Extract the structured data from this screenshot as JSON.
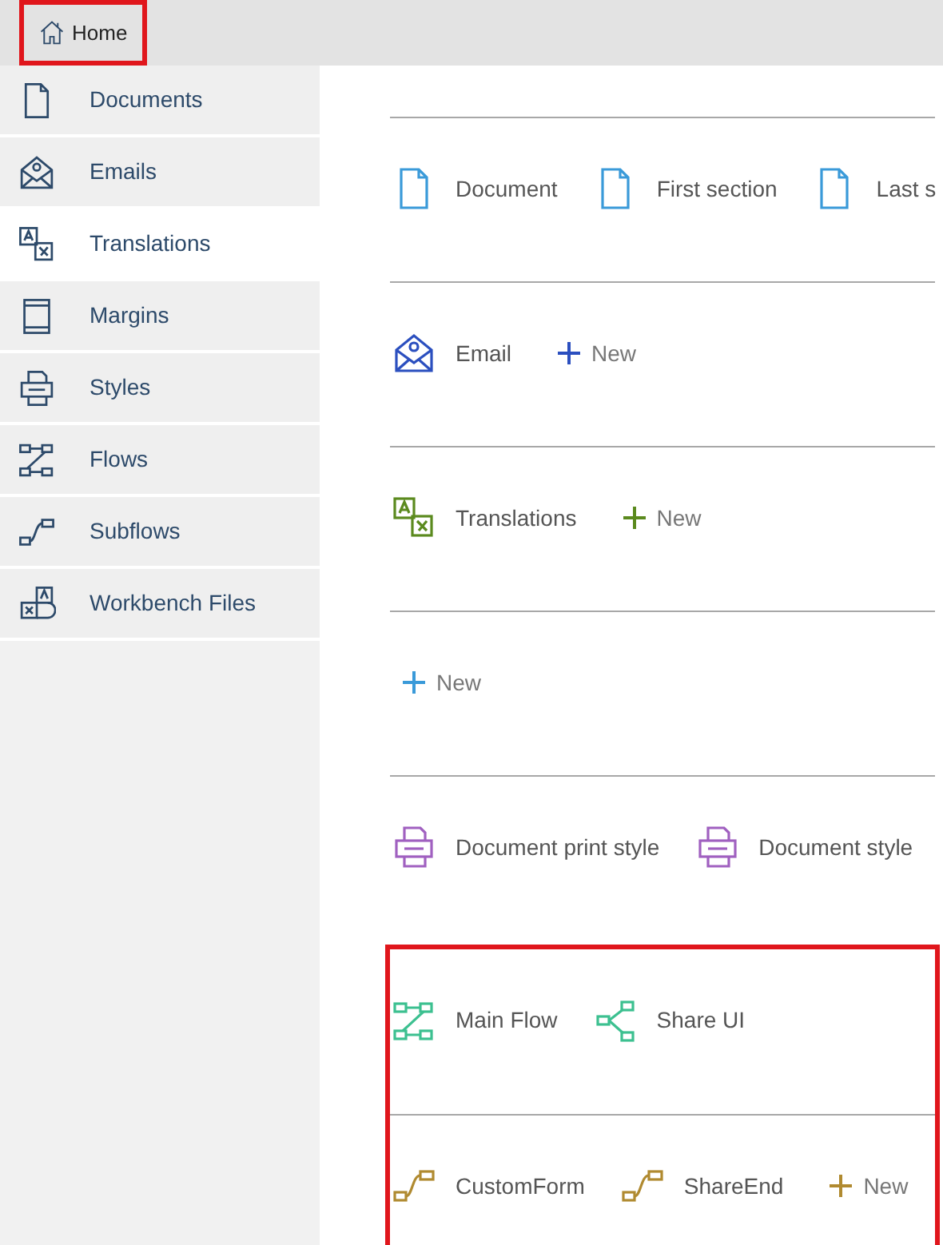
{
  "home": {
    "label": "Home",
    "highlighted": true
  },
  "sidebar": {
    "items": [
      {
        "label": "Documents",
        "kind": "document",
        "selected": false
      },
      {
        "label": "Emails",
        "kind": "email",
        "selected": false
      },
      {
        "label": "Translations",
        "kind": "translation",
        "selected": true
      },
      {
        "label": "Margins",
        "kind": "margin",
        "selected": false
      },
      {
        "label": "Styles",
        "kind": "style",
        "selected": false
      },
      {
        "label": "Flows",
        "kind": "flow",
        "selected": false
      },
      {
        "label": "Subflows",
        "kind": "subflow",
        "selected": false
      },
      {
        "label": "Workbench Files",
        "kind": "workbench",
        "selected": false
      }
    ]
  },
  "content": {
    "groups": [
      {
        "highlighted": false,
        "sections": [
          {
            "color": "#3a9ad9",
            "items": [
              {
                "kind": "document",
                "label": "Document"
              },
              {
                "kind": "document",
                "label": "First section"
              },
              {
                "kind": "document",
                "label": "Last s"
              }
            ]
          },
          {
            "color": "#2b4fbf",
            "items": [
              {
                "kind": "email",
                "label": "Email"
              },
              {
                "kind": "new",
                "label": "New"
              }
            ]
          },
          {
            "color": "#5b8a1e",
            "items": [
              {
                "kind": "translation",
                "label": "Translations"
              },
              {
                "kind": "new",
                "label": "New"
              }
            ]
          },
          {
            "color": "#3a9ad9",
            "items": [
              {
                "kind": "new",
                "label": "New"
              }
            ]
          },
          {
            "color": "#a060c0",
            "items": [
              {
                "kind": "style",
                "label": "Document print style"
              },
              {
                "kind": "style",
                "label": "Document style"
              }
            ]
          }
        ]
      },
      {
        "highlighted": true,
        "sections": [
          {
            "color": "#3cc090",
            "items": [
              {
                "kind": "flow",
                "label": "Main Flow"
              },
              {
                "kind": "branch",
                "label": "Share UI"
              }
            ]
          },
          {
            "color": "#b08a30",
            "items": [
              {
                "kind": "subflow",
                "label": "CustomForm"
              },
              {
                "kind": "subflow",
                "label": "ShareEnd"
              },
              {
                "kind": "new",
                "label": "New"
              }
            ]
          }
        ]
      }
    ]
  }
}
